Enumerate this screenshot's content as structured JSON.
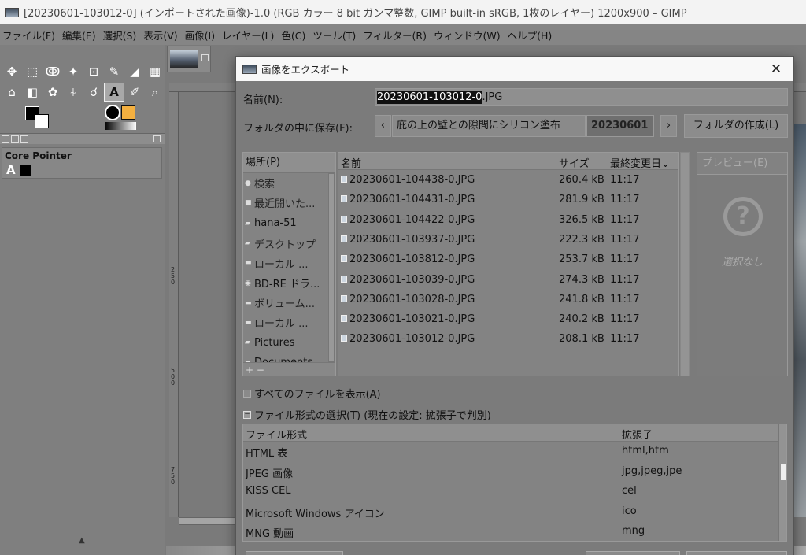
{
  "window": {
    "title": "[20230601-103012-0] (インポートされた画像)-1.0 (RGB カラー 8 bit ガンマ整数, GIMP built-in sRGB, 1枚のレイヤー) 1200x900 – GIMP"
  },
  "menu": [
    "ファイル(F)",
    "編集(E)",
    "選択(S)",
    "表示(V)",
    "画像(I)",
    "レイヤー(L)",
    "色(C)",
    "ツール(T)",
    "フィルター(R)",
    "ウィンドウ(W)",
    "ヘルプ(H)"
  ],
  "toolbox": {
    "row1": [
      "✥",
      "⬚",
      "ↂ",
      "✦",
      "⊡",
      "✎",
      "◢",
      "▦"
    ],
    "row2": [
      "⌂",
      "◧",
      "✿",
      "⍭",
      "☌",
      "A",
      "✐",
      "⌕"
    ],
    "device_status_title": "Core Pointer",
    "device_status_glyph": "A"
  },
  "canvas": {
    "ruler_marks": [
      "250",
      "500",
      "750"
    ]
  },
  "dialog": {
    "title": "画像をエクスポート",
    "close_glyph": "✕",
    "name_label": "名前(N):",
    "filename_selected": "20230601-103012-0",
    "filename_ext": ".JPG",
    "folder_label": "フォルダの中に保存(F):",
    "nav_back": "‹",
    "nav_forward": "›",
    "crumbs": [
      "庇の上の壁との隙間にシリコン塗布",
      "20230601"
    ],
    "create_folder": "フォルダの作成(L)",
    "places_header": "場所(P)",
    "places": [
      {
        "icon": "🔍",
        "label": "検索"
      },
      {
        "icon": "▤",
        "label": "最近開いた..."
      },
      {
        "icon": "▭",
        "label": "hana-51"
      },
      {
        "icon": "▭",
        "label": "デスクトップ"
      },
      {
        "icon": "▬",
        "label": "ローカル ..."
      },
      {
        "icon": "◉",
        "label": "BD-RE ドラ..."
      },
      {
        "icon": "▬",
        "label": "ボリューム..."
      },
      {
        "icon": "▬",
        "label": "ローカル ..."
      },
      {
        "icon": "▭",
        "label": "Pictures"
      },
      {
        "icon": "▭",
        "label": "Documents"
      }
    ],
    "places_footer": "+ −",
    "columns": {
      "name": "名前",
      "size": "サイズ",
      "modified": "最終変更日⌄"
    },
    "files": [
      {
        "name": "20230601-104438-0.JPG",
        "size": "260.4 kB",
        "time": "11:17"
      },
      {
        "name": "20230601-104431-0.JPG",
        "size": "281.9 kB",
        "time": "11:17"
      },
      {
        "name": "20230601-104422-0.JPG",
        "size": "326.5 kB",
        "time": "11:17"
      },
      {
        "name": "20230601-103937-0.JPG",
        "size": "222.3 kB",
        "time": "11:17"
      },
      {
        "name": "20230601-103812-0.JPG",
        "size": "253.7 kB",
        "time": "11:17"
      },
      {
        "name": "20230601-103039-0.JPG",
        "size": "274.3 kB",
        "time": "11:17"
      },
      {
        "name": "20230601-103028-0.JPG",
        "size": "241.8 kB",
        "time": "11:17"
      },
      {
        "name": "20230601-103021-0.JPG",
        "size": "240.2 kB",
        "time": "11:17"
      },
      {
        "name": "20230601-103012-0.JPG",
        "size": "208.1 kB",
        "time": "11:17"
      }
    ],
    "preview_label": "プレビュー(E)",
    "preview_glyph": "?",
    "preview_none": "選択なし",
    "show_all": "すべてのファイルを表示(A)",
    "type_select": "ファイル形式の選択(T) (現在の設定: 拡張子で判別)",
    "type_columns": {
      "type": "ファイル形式",
      "ext": "拡張子"
    },
    "types": [
      {
        "type": "HTML 表",
        "ext": "html,htm"
      },
      {
        "type": "JPEG 画像",
        "ext": "jpg,jpeg,jpe"
      },
      {
        "type": "KISS CEL",
        "ext": "cel"
      },
      {
        "type": "Microsoft Windows アイコン",
        "ext": "ico"
      },
      {
        "type": "MNG 動画",
        "ext": "mng"
      }
    ]
  }
}
